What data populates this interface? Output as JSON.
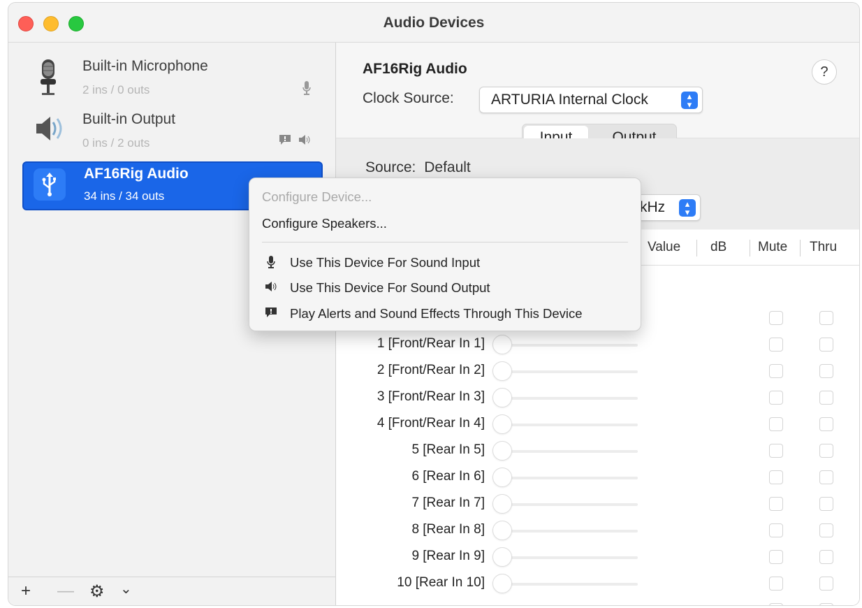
{
  "window": {
    "title": "Audio Devices"
  },
  "sidebar": {
    "devices": [
      {
        "name": "Built-in Microphone",
        "subtitle": "2 ins / 0 outs",
        "icon": "microphone-icon",
        "right_icons": [
          "mic-small-icon"
        ]
      },
      {
        "name": "Built-in Output",
        "subtitle": "0 ins / 2 outs",
        "icon": "speaker-icon",
        "right_icons": [
          "alert-icon",
          "speaker-small-icon"
        ]
      },
      {
        "name": "AF16Rig Audio",
        "subtitle": "34 ins / 34 outs",
        "icon": "usb-icon",
        "selected": true
      }
    ],
    "footer": {
      "add": "+",
      "remove": "—",
      "gear": "⚙",
      "chevron": "⌄"
    }
  },
  "main": {
    "device_title": "AF16Rig Audio",
    "help": "?",
    "clock_label": "Clock Source:",
    "clock_value": "ARTURIA Internal Clock",
    "tabs": [
      "Input",
      "Output"
    ],
    "source_label": "Source:",
    "source_value": "Default",
    "format_value": "kHz",
    "columns": [
      "Value",
      "dB",
      "Mute",
      "Thru"
    ],
    "channels": [
      "1 [Front/Rear In 1]",
      "2 [Front/Rear In 2]",
      "3 [Front/Rear In 3]",
      "4 [Front/Rear In 4]",
      "5 [Rear In 5]",
      "6 [Rear In 6]",
      "7 [Rear In 7]",
      "8 [Rear In 8]",
      "9 [Rear In 9]",
      "10 [Rear In 10]"
    ]
  },
  "context_menu": {
    "configure_device": "Configure Device...",
    "configure_speakers": "Configure Speakers...",
    "use_input": "Use This Device For Sound Input",
    "use_output": "Use This Device For Sound Output",
    "play_alerts": "Play Alerts and Sound Effects Through This Device"
  },
  "colors": {
    "selection": "#1a66e8",
    "accent": "#2d7cf6",
    "close": "#fe5f57",
    "minimize": "#febc2e",
    "zoom": "#28c840"
  }
}
